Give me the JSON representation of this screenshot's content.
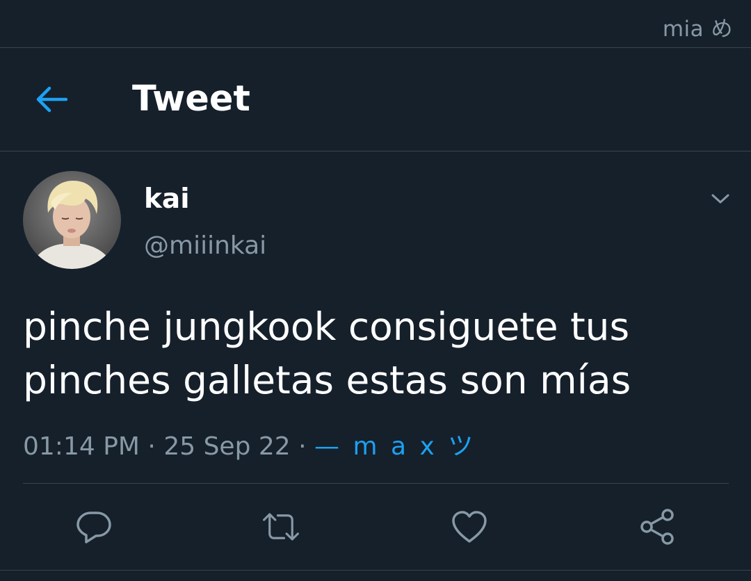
{
  "status": {
    "text": "mia め"
  },
  "header": {
    "title": "Tweet",
    "back_icon": "back-arrow-icon"
  },
  "tweet": {
    "display_name": "kai",
    "handle": "@miiinkai",
    "text": "pinche jungkook consiguete tus pinches galletas estas son mías",
    "time": "01:14 PM",
    "date": "25 Sep 22",
    "separator": "·",
    "source": "— m a x ツ"
  },
  "actions": [
    {
      "name": "reply",
      "icon": "reply-icon"
    },
    {
      "name": "retweet",
      "icon": "retweet-icon"
    },
    {
      "name": "like",
      "icon": "heart-icon"
    },
    {
      "name": "share",
      "icon": "share-icon"
    }
  ],
  "colors": {
    "background": "#15202b",
    "accent": "#1da1f2",
    "secondary_text": "#8899a6",
    "divider": "#38444d"
  }
}
